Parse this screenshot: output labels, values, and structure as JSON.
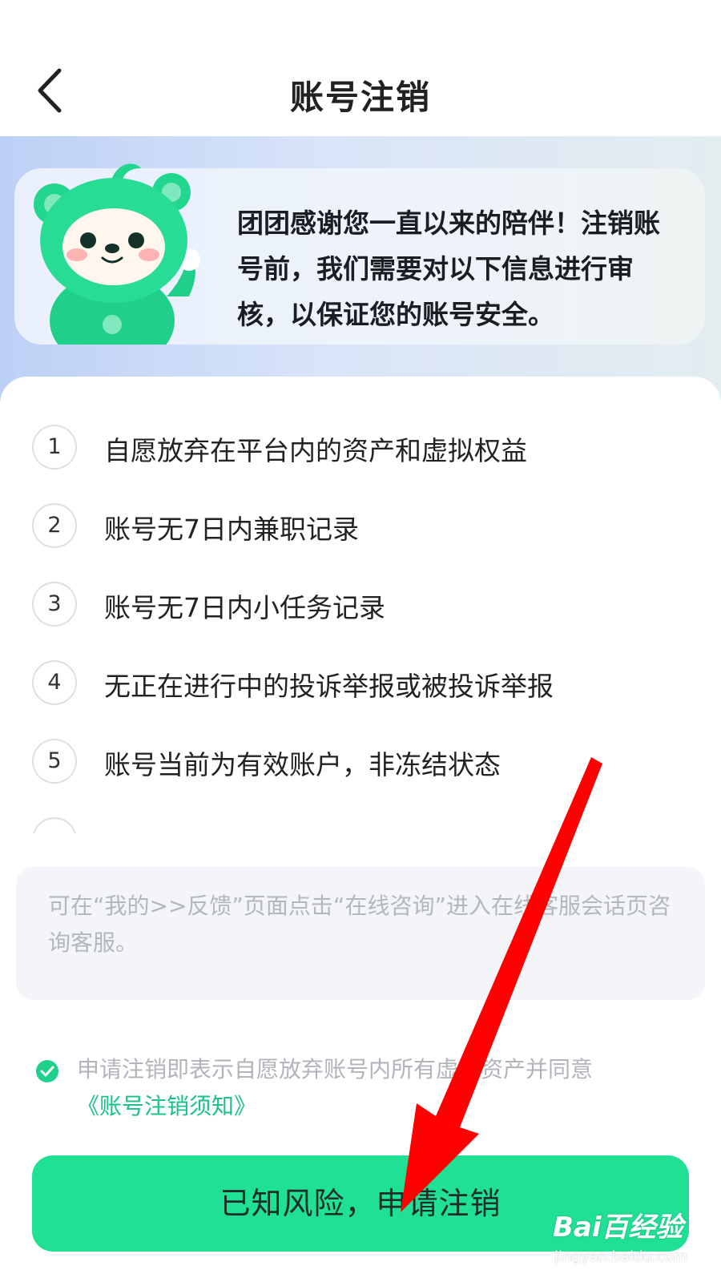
{
  "header": {
    "title": "账号注销",
    "back_icon": "chevron-left-icon"
  },
  "banner": {
    "message": "团团感谢您一直以来的陪伴！注销账号前，我们需要对以下信息进行审核，以保证您的账号安全。",
    "mascot": "mascot-illustration"
  },
  "requirements": [
    {
      "num": "1",
      "text": "自愿放弃在平台内的资产和虚拟权益"
    },
    {
      "num": "2",
      "text": "账号无7日内兼职记录"
    },
    {
      "num": "3",
      "text": "账号无7日内小任务记录"
    },
    {
      "num": "4",
      "text": "无正在进行中的投诉举报或被投诉举报"
    },
    {
      "num": "5",
      "text": "账号当前为有效账户，非冻结状态"
    }
  ],
  "note": {
    "text": "可在“我的>>反馈”页面点击“在线咨询”进入在线客服会话页咨询客服。"
  },
  "agreement": {
    "checked": true,
    "text": "申请注销即表示自愿放弃账号内所有虚拟资产并同意",
    "link": "《账号注销须知》"
  },
  "action": {
    "confirm_label": "已知风险，申请注销"
  },
  "watermark": {
    "brand": "Bai百经验",
    "site": "jingyan.baidu.com"
  },
  "colors": {
    "accent": "#1fe094",
    "link": "#19c08a",
    "arrow": "#ff0000"
  }
}
